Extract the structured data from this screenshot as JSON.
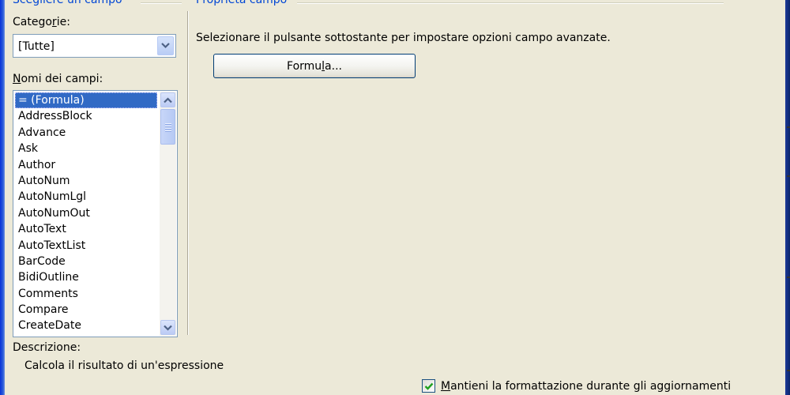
{
  "left_group": {
    "legend": "Scegliere un campo",
    "categories_label_pre": "Catego",
    "categories_label_u": "r",
    "categories_label_post": "ie:",
    "categories_value": "[Tutte]",
    "field_names_label_u": "N",
    "field_names_label_post": "omi dei campi:",
    "field_names": [
      "= (Formula)",
      "AddressBlock",
      "Advance",
      "Ask",
      "Author",
      "AutoNum",
      "AutoNumLgl",
      "AutoNumOut",
      "AutoText",
      "AutoTextList",
      "BarCode",
      "BidiOutline",
      "Comments",
      "Compare",
      "CreateDate"
    ],
    "selected_index": 0,
    "description_label": "Descrizione:",
    "description_text": "Calcola il risultato di un'espressione"
  },
  "right_group": {
    "legend": "Proprietà campo",
    "instruction": "Selezionare il pulsante sottostante per impostare opzioni campo avanzate.",
    "formula_button_pre": "Formu",
    "formula_button_u": "l",
    "formula_button_post": "a..."
  },
  "preserve_formatting": {
    "checked": true,
    "label_u": "M",
    "label_post": "antieni la formattazione durante gli aggiornamenti"
  },
  "colors": {
    "legend": "#0046d5",
    "selection": "#316ac5",
    "dialog_bg": "#ece9d8",
    "checkmark": "#21a121"
  }
}
